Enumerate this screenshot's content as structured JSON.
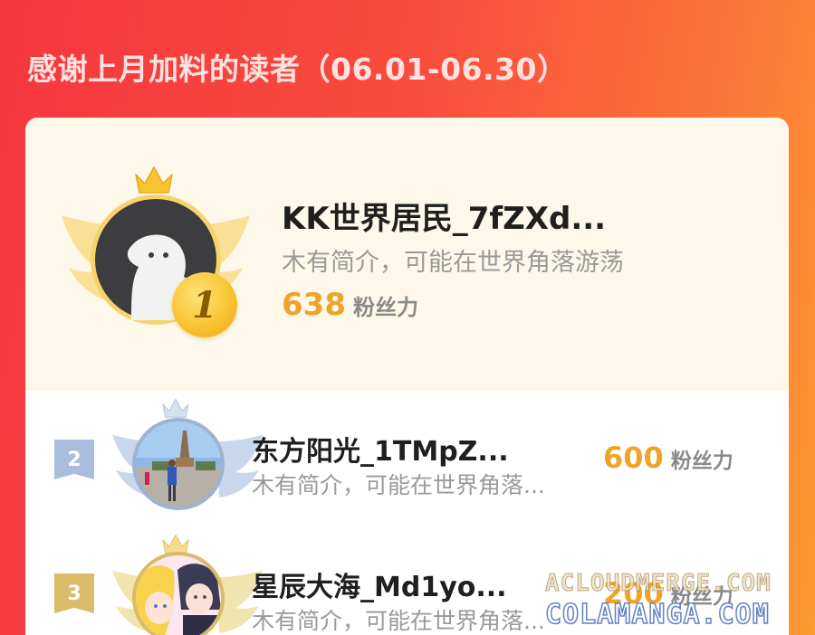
{
  "page": {
    "title": "感谢上月加料的读者（06.01-06.30）"
  },
  "leaderboard": [
    {
      "rank": "1",
      "name": "KK世界居民_7fZXd...",
      "bio": "木有简介，可能在世界角落游荡",
      "score": "638",
      "unit": "粉丝力"
    },
    {
      "rank": "2",
      "name": "东方阳光_1TMpZ...",
      "bio": "木有简介，可能在世界角落...",
      "score": "600",
      "unit": "粉丝力"
    },
    {
      "rank": "3",
      "name": "星辰大海_Md1yo...",
      "bio": "木有简介，可能在世界角落...",
      "score": "200",
      "unit": "粉丝力"
    }
  ],
  "watermark": {
    "line1": "ACLOUDMERGE.COM",
    "line2": "COLAMANGA.COM"
  },
  "colors": {
    "gold": "#f0a427",
    "silver": "#9fb3d1",
    "bronze": "#d9bb68"
  }
}
